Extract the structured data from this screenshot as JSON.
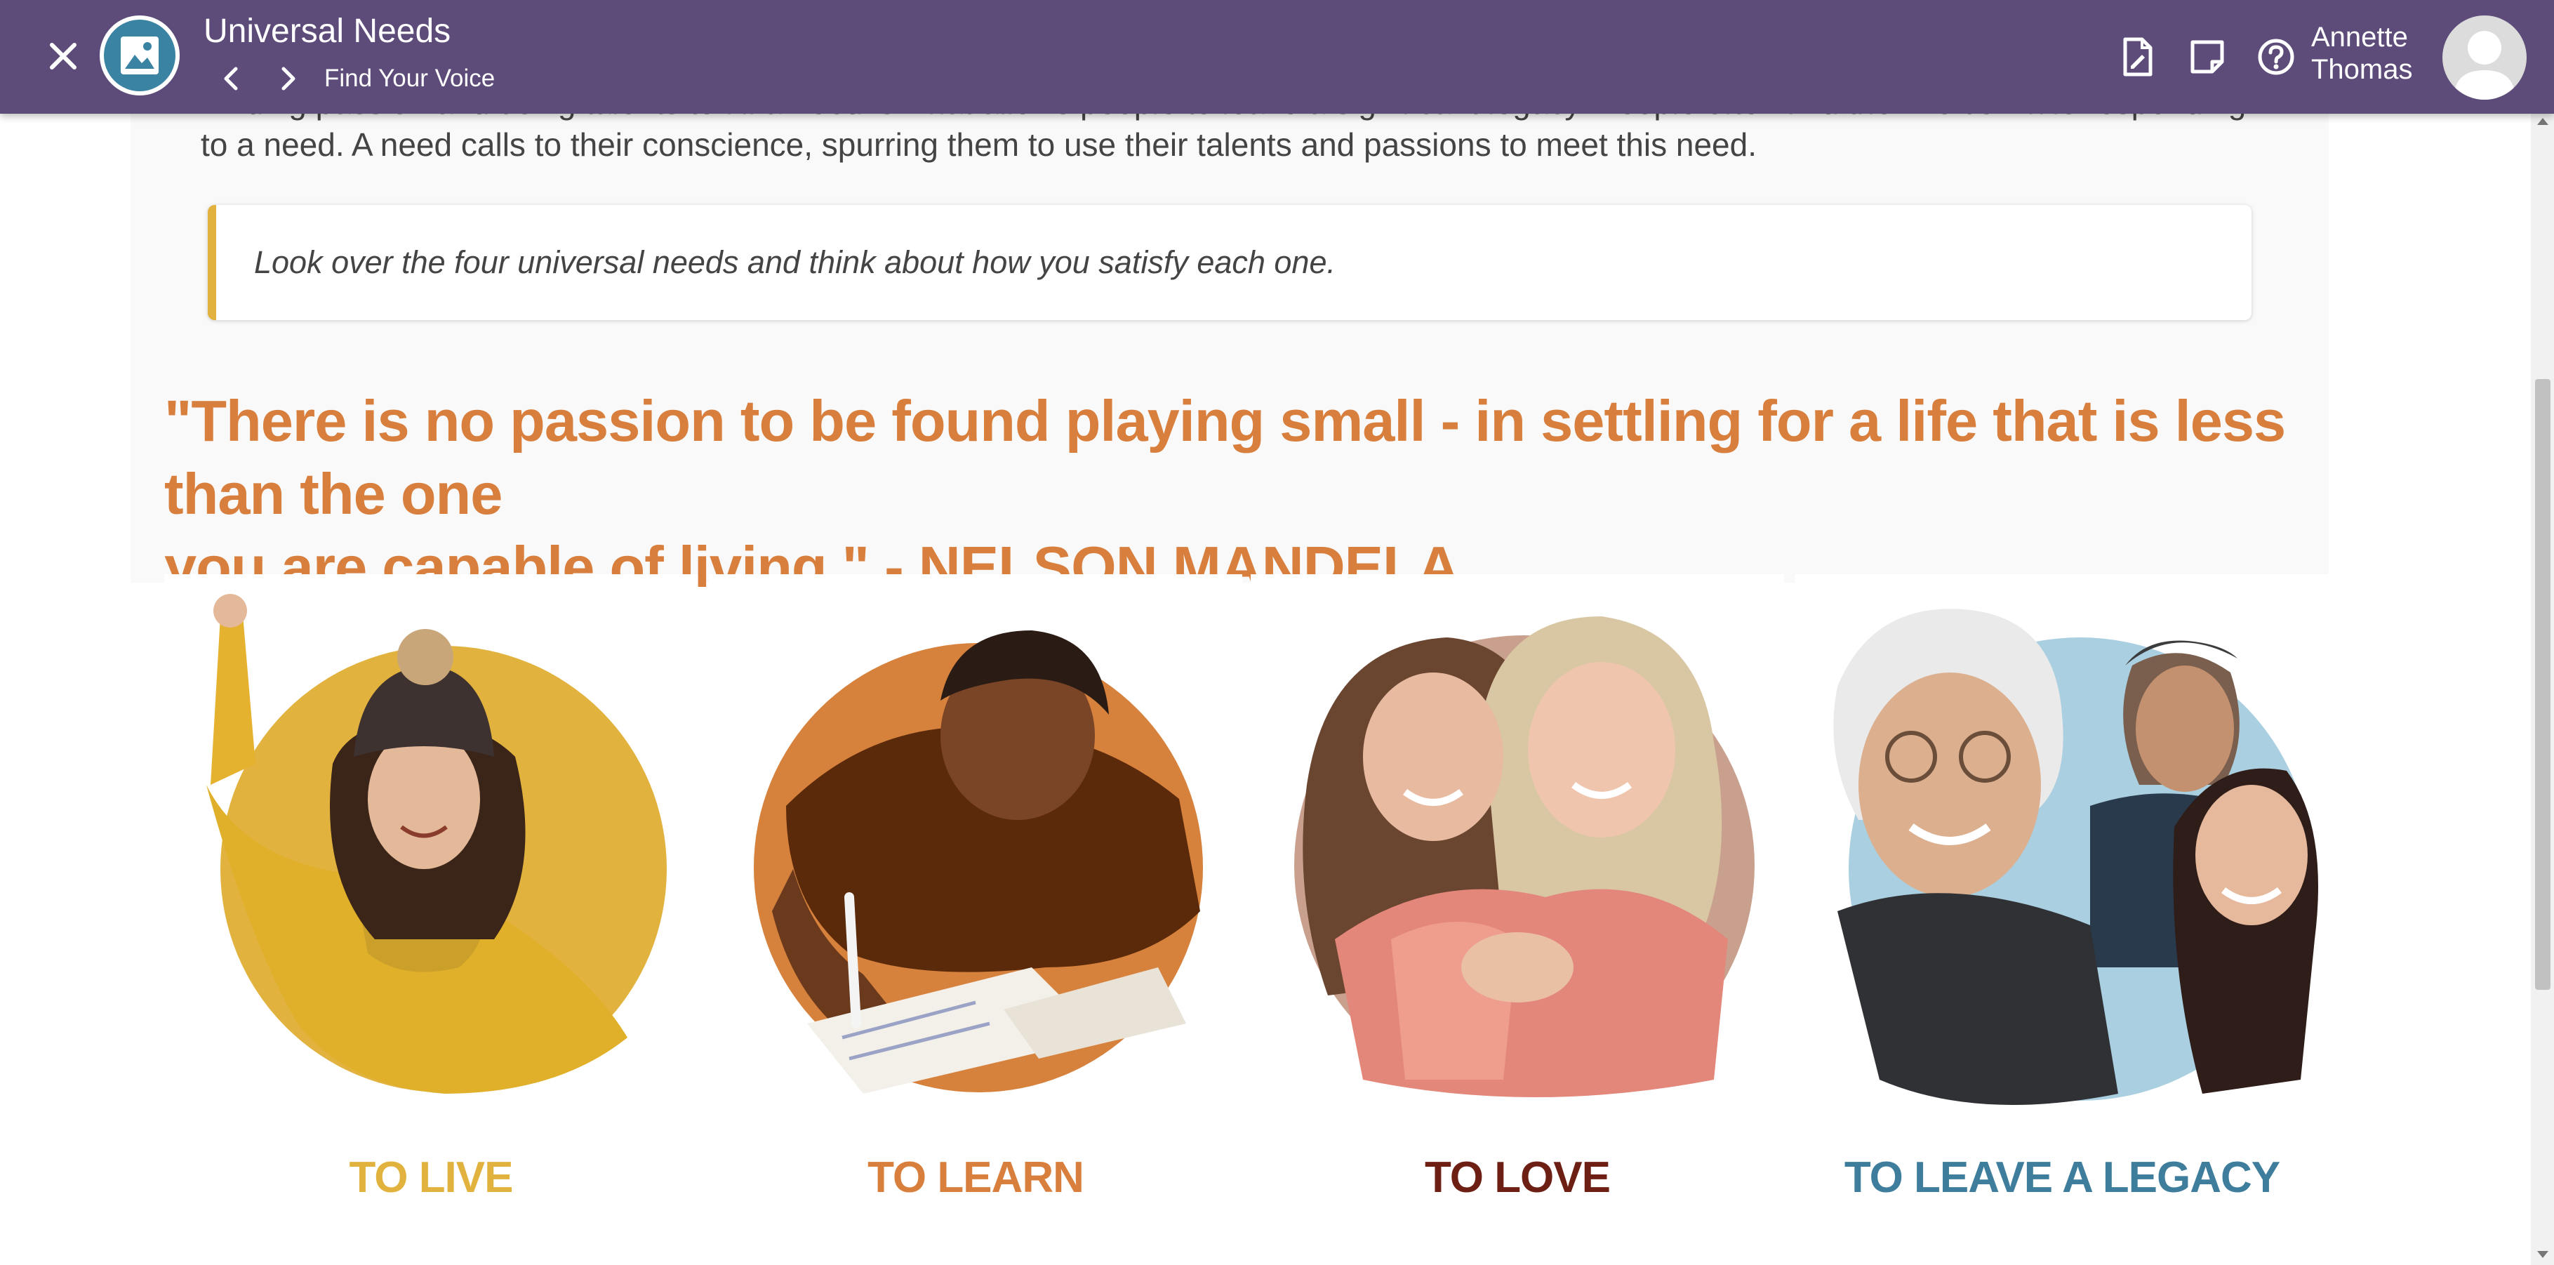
{
  "header": {
    "title": "Universal Needs",
    "subtitle": "Find Your Voice",
    "user_name_first": "Annette",
    "user_name_last": "Thomas",
    "background": "#5d4c79"
  },
  "icons": {
    "close": "close-icon",
    "app": "image-icon",
    "prev": "chevron-left-icon",
    "next": "chevron-right-icon",
    "pdf": "pdf-document-icon",
    "notes": "note-icon",
    "help": "help-circle-icon",
    "user": "user-avatar-icon"
  },
  "content": {
    "intro_line1": "Finding passion and using talents to fill a need is what allows people to leave a significant legacy. People often find their voice while responding",
    "intro_line2": "to a need. A need calls to their conscience, spurring them to use their talents and passions to meet this need.",
    "callout": "Look over the four universal needs and think about how you satisfy each one.",
    "quote_line1": "\"There is no passion to be found playing small - in settling for a life that is less than the one",
    "quote_line2": "you are capable of living.\" - NELSON MANDELA",
    "quote_color": "#d87f3d",
    "callout_accent": "#e2b23e"
  },
  "cards": [
    {
      "label": "TO LIVE",
      "color": "#e2b23e",
      "circle_color": "#e2b23e"
    },
    {
      "label": "TO LEARN",
      "color": "#d87f3d",
      "circle_color": "#d6813c"
    },
    {
      "label": "TO LOVE",
      "color": "#6d1f13",
      "circle_color": "#c9a08e"
    },
    {
      "label": "TO LEAVE A LEGACY",
      "color": "#3e7d9c",
      "circle_color": "#a9cfe0"
    }
  ]
}
